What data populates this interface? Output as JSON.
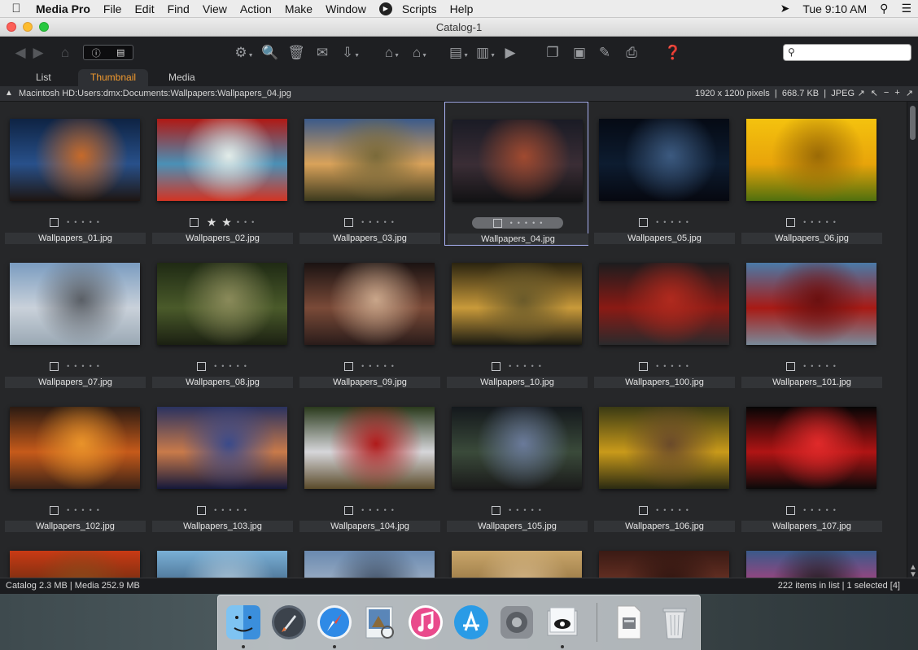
{
  "menubar": {
    "app": "Media Pro",
    "items": [
      "File",
      "Edit",
      "Find",
      "View",
      "Action",
      "Make",
      "Window",
      "Scripts",
      "Help"
    ],
    "clock": "Tue 9:10 AM"
  },
  "window": {
    "title": "Catalog-1"
  },
  "tabs": [
    "List",
    "Thumbnail",
    "Media"
  ],
  "active_tab": "Thumbnail",
  "pathbar": {
    "path": "Macintosh HD:Users:dmx:Documents:Wallpapers:Wallpapers_04.jpg",
    "dimensions": "1920 x 1200 pixels",
    "size": "668.7 KB",
    "format": "JPEG",
    "separator": "|"
  },
  "search": {
    "placeholder": "",
    "value": ""
  },
  "grid": {
    "items": [
      {
        "name": "Wallpapers_01.jpg",
        "stars": 0,
        "colors": [
          "#0e2343",
          "#28508a",
          "#c66a2a",
          "#1e1612"
        ]
      },
      {
        "name": "Wallpapers_02.jpg",
        "stars": 2,
        "colors": [
          "#b01914",
          "#4a90b6",
          "#e2ece9",
          "#d33423"
        ]
      },
      {
        "name": "Wallpapers_03.jpg",
        "stars": 0,
        "colors": [
          "#3b5a8a",
          "#d9a25a",
          "#7a6a3a",
          "#3c3a1e"
        ]
      },
      {
        "name": "Wallpapers_04.jpg",
        "stars": 0,
        "selected": true,
        "colors": [
          "#1a1b25",
          "#3a2d35",
          "#a04a30",
          "#121214"
        ]
      },
      {
        "name": "Wallpapers_05.jpg",
        "stars": 0,
        "colors": [
          "#050a14",
          "#0d1c30",
          "#3c5a80",
          "#060810"
        ]
      },
      {
        "name": "Wallpapers_06.jpg",
        "stars": 0,
        "colors": [
          "#f4c20e",
          "#e8a40a",
          "#9a6a06",
          "#50700e"
        ]
      },
      {
        "name": "Wallpapers_07.jpg",
        "stars": 0,
        "colors": [
          "#7a9cc0",
          "#c9d1da",
          "#5a5f66",
          "#9aa8b4"
        ]
      },
      {
        "name": "Wallpapers_08.jpg",
        "stars": 0,
        "colors": [
          "#1f2a14",
          "#4a5a2a",
          "#8a8a5a",
          "#1b2012"
        ]
      },
      {
        "name": "Wallpapers_09.jpg",
        "stars": 0,
        "colors": [
          "#1a1212",
          "#7a4a38",
          "#c9a68a",
          "#2a1c1a"
        ]
      },
      {
        "name": "Wallpapers_10.jpg",
        "stars": 0,
        "colors": [
          "#2a2410",
          "#c99a3a",
          "#6a5a2a",
          "#1a1a12"
        ]
      },
      {
        "name": "Wallpapers_100.jpg",
        "stars": 0,
        "colors": [
          "#1c1c1e",
          "#8a1a14",
          "#b02a1e",
          "#2a2a2c"
        ]
      },
      {
        "name": "Wallpapers_101.jpg",
        "stars": 0,
        "colors": [
          "#4a7aa8",
          "#a81a14",
          "#6a1010",
          "#7a8a9a"
        ]
      },
      {
        "name": "Wallpapers_102.jpg",
        "stars": 0,
        "colors": [
          "#2a1a12",
          "#c65a1a",
          "#e9932a",
          "#3a2216"
        ]
      },
      {
        "name": "Wallpapers_103.jpg",
        "stars": 0,
        "colors": [
          "#2a3260",
          "#c97a4a",
          "#3a4a8a",
          "#14183a"
        ]
      },
      {
        "name": "Wallpapers_104.jpg",
        "stars": 0,
        "colors": [
          "#2a3a1c",
          "#d6d6da",
          "#b01a1a",
          "#5a4a2a"
        ]
      },
      {
        "name": "Wallpapers_105.jpg",
        "stars": 0,
        "colors": [
          "#14181c",
          "#3a4a3a",
          "#6a7a9a",
          "#1a1a1a"
        ]
      },
      {
        "name": "Wallpapers_106.jpg",
        "stars": 0,
        "colors": [
          "#3a3a14",
          "#c99a1a",
          "#6a4a2a",
          "#2a2a12"
        ]
      },
      {
        "name": "Wallpapers_107.jpg",
        "stars": 0,
        "colors": [
          "#050505",
          "#b01414",
          "#e02a2a",
          "#0a0a0a"
        ]
      },
      {
        "name": "",
        "stars": 0,
        "partial": true,
        "colors": [
          "#c93a14",
          "#5a2a10",
          "#8a4a1a",
          "#2a1a10"
        ]
      },
      {
        "name": "",
        "stars": 0,
        "partial": true,
        "colors": [
          "#7ab0d6",
          "#3a5a7a",
          "#b0c8da",
          "#5a7a9a"
        ]
      },
      {
        "name": "",
        "stars": 0,
        "partial": true,
        "colors": [
          "#6a8ab0",
          "#b0bccc",
          "#3a4a60",
          "#8a9ab0"
        ]
      },
      {
        "name": "",
        "stars": 0,
        "partial": true,
        "colors": [
          "#c9a66a",
          "#8a6a3a",
          "#d6b88a",
          "#5a4a2a"
        ]
      },
      {
        "name": "",
        "stars": 0,
        "partial": true,
        "colors": [
          "#3a1a14",
          "#7a3a2a",
          "#2a120e",
          "#5a2a1e"
        ]
      },
      {
        "name": "",
        "stars": 0,
        "partial": true,
        "colors": [
          "#3a5a8a",
          "#c93a7a",
          "#1a1a1a",
          "#6a6a6a"
        ]
      }
    ]
  },
  "status": {
    "catalog": "Catalog  2.3 MB  |  Media 252.9 MB",
    "items": "222 items in list  |  1 selected [4]"
  },
  "dock": {
    "apps": [
      "finder-icon",
      "launchpad-icon",
      "safari-icon",
      "preview-icon",
      "itunes-icon",
      "app-store-icon",
      "system-preferences-icon",
      "media-pro-icon",
      "document-icon",
      "trash-icon"
    ]
  },
  "colors": {
    "accent_tab": "#f29a2e",
    "selection_border": "#aab2f4"
  }
}
